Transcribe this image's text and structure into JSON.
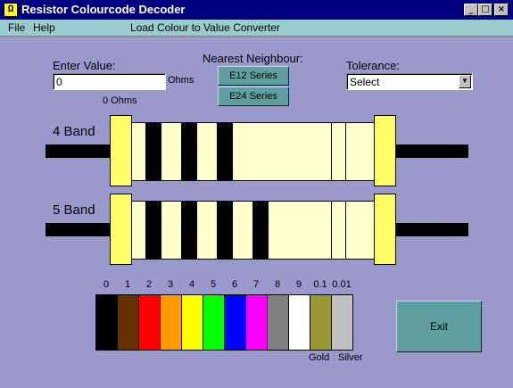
{
  "window": {
    "title": "Resistor Colourcode Decoder",
    "icon_glyph": "Ω",
    "min_glyph": "_",
    "max_glyph": "□",
    "close_glyph": "×"
  },
  "menu": {
    "file": "File",
    "help": "Help",
    "converter": "Load Colour to Value Converter"
  },
  "input": {
    "label": "Enter Value:",
    "value": "0",
    "unit": "Ohms",
    "readout": "0 Ohms"
  },
  "nearest": {
    "label": "Nearest Neighbour:",
    "e12": "E12 Series",
    "e24": "E24 Series"
  },
  "tolerance": {
    "label": "Tolerance:",
    "selected": "Select"
  },
  "bands": {
    "four_label": "4 Band",
    "five_label": "5 Band"
  },
  "palette": [
    {
      "label": "0",
      "color": "#000000"
    },
    {
      "label": "1",
      "color": "#663300"
    },
    {
      "label": "2",
      "color": "#ff0000"
    },
    {
      "label": "3",
      "color": "#ff9900"
    },
    {
      "label": "4",
      "color": "#ffff00"
    },
    {
      "label": "5",
      "color": "#00ff00"
    },
    {
      "label": "6",
      "color": "#0000ff"
    },
    {
      "label": "7",
      "color": "#ff00ff"
    },
    {
      "label": "8",
      "color": "#808080"
    },
    {
      "label": "9",
      "color": "#ffffff"
    },
    {
      "label": "0.1",
      "color": "#999933"
    },
    {
      "label": "0.01",
      "color": "#c0c0c0"
    }
  ],
  "palette_names": {
    "gold": "Gold",
    "silver": "Silver"
  },
  "exit_label": "Exit"
}
